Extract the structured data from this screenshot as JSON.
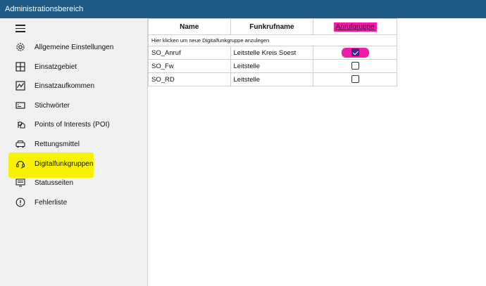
{
  "window": {
    "title": "Administrationsbereich"
  },
  "sidebar": {
    "items": [
      {
        "label": "Allgemeine Einstellungen",
        "icon": "gear-icon"
      },
      {
        "label": "Einsatzgebiet",
        "icon": "grid-map-icon"
      },
      {
        "label": "Einsatzaufkommen",
        "icon": "line-chart-icon"
      },
      {
        "label": "Stichwörter",
        "icon": "keyboard-icon"
      },
      {
        "label": "Points of Interests (POI)",
        "icon": "poi-icon"
      },
      {
        "label": "Rettungsmittel",
        "icon": "vehicle-icon"
      },
      {
        "label": "Digitalfunkgruppen",
        "icon": "headset-icon"
      },
      {
        "label": "Statusseiten",
        "icon": "monitor-icon"
      },
      {
        "label": "Fehlerliste",
        "icon": "warning-circle-icon"
      }
    ]
  },
  "table": {
    "headers": {
      "name": "Name",
      "funkrufname": "Funkrufname",
      "anrufgruppe": "Anrufgruppe"
    },
    "hint": "Hier klicken um neue Digitalfunkgruppe anzulegen",
    "rows": [
      {
        "name": "SO_Anruf",
        "funkrufname": "Leitstelle Kreis Soest",
        "anrufgruppe": true
      },
      {
        "name": "SO_Fw",
        "funkrufname": "Leitstelle",
        "anrufgruppe": false
      },
      {
        "name": "SO_RD",
        "funkrufname": "Leitstelle",
        "anrufgruppe": false
      }
    ]
  },
  "colors": {
    "titlebar": "#1f5b86",
    "sidebar": "#f0f0f0",
    "highlight_yellow": "#f7f200",
    "highlight_pink": "#ee1ca8"
  }
}
